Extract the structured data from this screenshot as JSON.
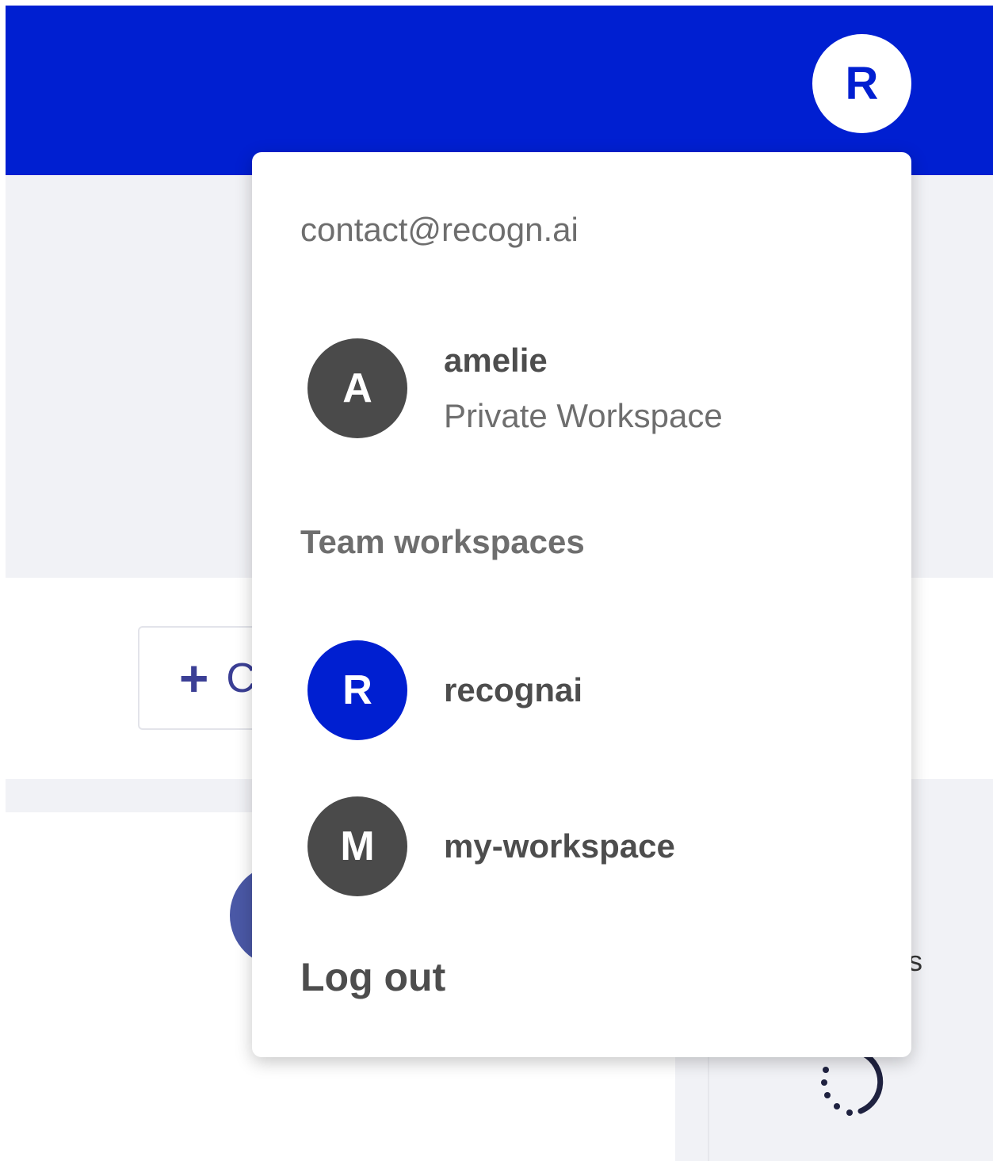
{
  "header": {
    "user_initial": "R",
    "colors": {
      "bar": "#001fd1",
      "avatar_bg": "#ffffff"
    }
  },
  "background": {
    "create_button": {
      "icon": "plus-icon",
      "label": "C"
    },
    "edge_text": "s"
  },
  "dropdown": {
    "email": "contact@recogn.ai",
    "private_workspace": {
      "initial": "A",
      "name": "amelie",
      "subtitle": "Private Workspace",
      "color": "#4a4a4a"
    },
    "team_section_title": "Team workspaces",
    "team_workspaces": [
      {
        "initial": "R",
        "name": "recognai",
        "color": "#001fd1"
      },
      {
        "initial": "M",
        "name": "my-workspace",
        "color": "#4a4a4a"
      }
    ],
    "logout_label": "Log out"
  }
}
